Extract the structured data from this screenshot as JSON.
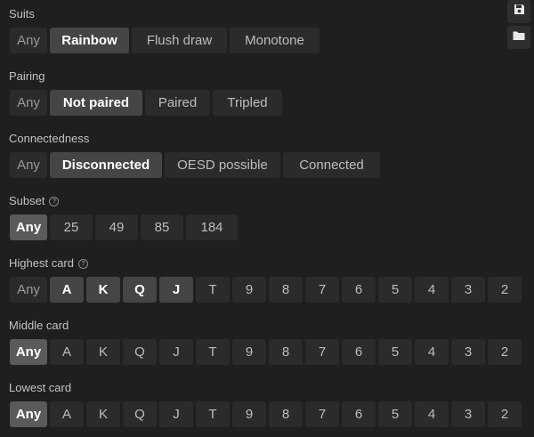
{
  "toolbar": {
    "save_icon": "save-icon",
    "folder_icon": "folder-icon"
  },
  "suits": {
    "label": "Suits",
    "options": [
      "Any",
      "Rainbow",
      "Flush draw",
      "Monotone"
    ],
    "selected": [
      "Rainbow"
    ]
  },
  "pairing": {
    "label": "Pairing",
    "options": [
      "Any",
      "Not paired",
      "Paired",
      "Tripled"
    ],
    "selected": [
      "Not paired"
    ]
  },
  "connectedness": {
    "label": "Connectedness",
    "options": [
      "Any",
      "Disconnected",
      "OESD possible",
      "Connected"
    ],
    "selected": [
      "Disconnected"
    ]
  },
  "subset": {
    "label": "Subset",
    "help_icon": "question-circle-icon",
    "options": [
      "Any",
      "25",
      "49",
      "85",
      "184"
    ],
    "selected": [
      "Any"
    ]
  },
  "highest_card": {
    "label": "Highest card",
    "help_icon": "question-circle-icon",
    "options": [
      "Any",
      "A",
      "K",
      "Q",
      "J",
      "T",
      "9",
      "8",
      "7",
      "6",
      "5",
      "4",
      "3",
      "2"
    ],
    "selected": [
      "A",
      "K",
      "Q",
      "J"
    ]
  },
  "middle_card": {
    "label": "Middle card",
    "options": [
      "Any",
      "A",
      "K",
      "Q",
      "J",
      "T",
      "9",
      "8",
      "7",
      "6",
      "5",
      "4",
      "3",
      "2"
    ],
    "selected": [
      "Any"
    ]
  },
  "lowest_card": {
    "label": "Lowest card",
    "options": [
      "Any",
      "A",
      "K",
      "Q",
      "J",
      "T",
      "9",
      "8",
      "7",
      "6",
      "5",
      "4",
      "3",
      "2"
    ],
    "selected": [
      "Any"
    ]
  },
  "colors": {
    "background": "#1f1f1f",
    "segment": "#2b2b2b",
    "segment_active": "#454545",
    "any_active": "#5a5a5a"
  }
}
